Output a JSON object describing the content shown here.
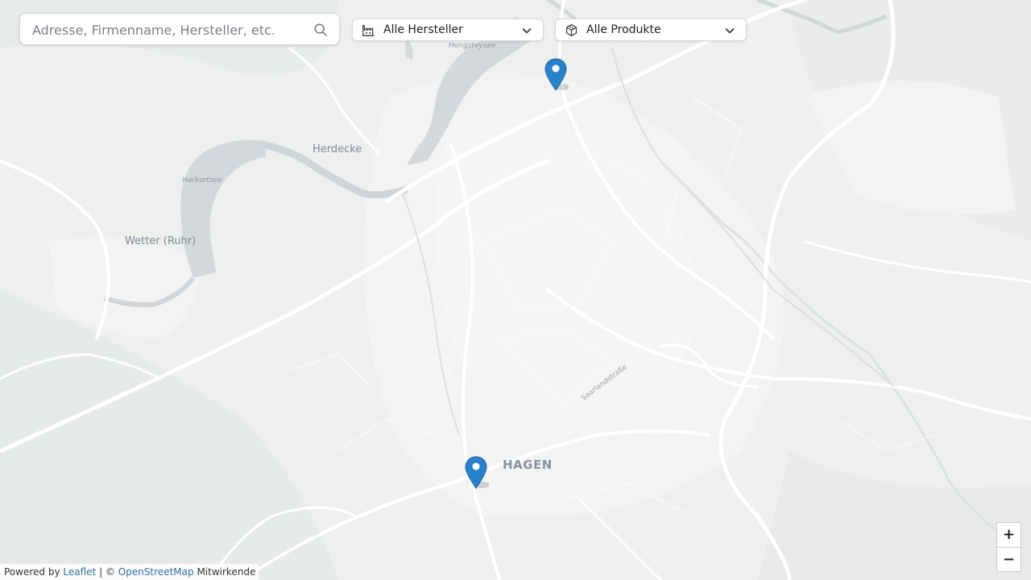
{
  "search": {
    "placeholder": "Adresse, Firmenname, Hersteller, etc.",
    "icon": "search-icon"
  },
  "filters": {
    "manufacturer": {
      "label": "Alle Hersteller",
      "icon": "factory-icon"
    },
    "product": {
      "label": "Alle Produkte",
      "icon": "box-icon"
    }
  },
  "map": {
    "places": {
      "hengsteysee": "Hengsteysee",
      "herdecke": "Herdecke",
      "harkortsee": "Harkortsee",
      "wetter": "Wetter (Ruhr)",
      "hagen": "HAGEN",
      "saarlandstrasse": "Saarlandstraße"
    },
    "marker_color": "#2a81cb",
    "water_color": "#d4d8db"
  },
  "zoom": {
    "in": "+",
    "out": "−"
  },
  "attribution": {
    "prefix": "Powered by",
    "leaflet": "Leaflet",
    "separator": "| ©",
    "osm": "OpenStreetMap",
    "suffix": "Mitwirkende"
  }
}
